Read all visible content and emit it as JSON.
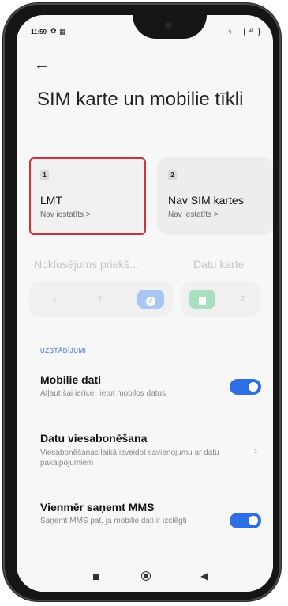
{
  "status_bar": {
    "time": "11:59",
    "signal": "⁴ᵢₗ",
    "battery": "41"
  },
  "header": {
    "title": "SIM karte un mobilie tīkli"
  },
  "sim_cards": [
    {
      "slot": "1",
      "name": "LMT",
      "status": "Nav iestatīts >"
    },
    {
      "slot": "2",
      "name": "Nav SIM kartes",
      "status": "Nav iestatīts >"
    }
  ],
  "default_for": {
    "label": "Noklusējums priekš...",
    "items": [
      "1",
      "2"
    ]
  },
  "data_card": {
    "label": "Datu karte",
    "items": [
      "1",
      "2"
    ]
  },
  "settings": {
    "group_header": "UZSTĀDĪJUMI",
    "mobile_data": {
      "title": "Mobilie dati",
      "subtitle": "Atļaut šai ierīcei lietot mobilos datus",
      "enabled": true
    },
    "data_roaming": {
      "title": "Datu viesabonēšana",
      "subtitle": "Viesabonēšanas laikā izveidot savienojumu ar datu pakalpojumiem"
    },
    "always_mms": {
      "title": "Vienmēr saņemt MMS",
      "subtitle": "Saņemt MMS pat, ja mobilie dati ir izslēgti",
      "enabled": true
    }
  },
  "colors": {
    "accent_blue": "#2f6fe6",
    "selected_border": "#cf3143",
    "data_green": "#a9dec0"
  }
}
